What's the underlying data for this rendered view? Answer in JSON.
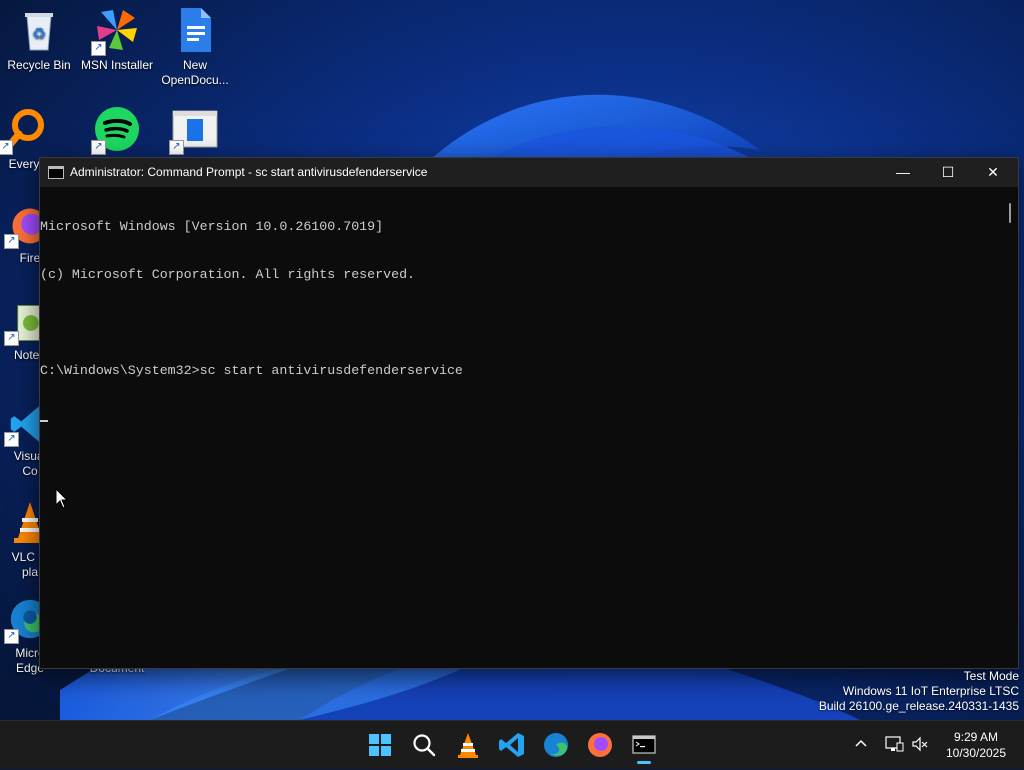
{
  "desktop": {
    "icons": [
      {
        "label": "Recycle Bin",
        "icon": "recycle-bin-icon"
      },
      {
        "label": "MSN Installer",
        "icon": "msn-icon"
      },
      {
        "label": "New OpenDocu...",
        "icon": "document-icon"
      },
      {
        "label": "Every",
        "icon": "everything-search-icon"
      },
      {
        "label": "",
        "icon": "spotify-icon"
      },
      {
        "label": "",
        "icon": "window-app-icon"
      },
      {
        "label": "Fire",
        "icon": "firefox-icon"
      },
      {
        "label": "Notep",
        "icon": "notepad-icon"
      },
      {
        "label": "Visual\nCo",
        "icon": "vscode-icon"
      },
      {
        "label": "VLC m\npla",
        "icon": "vlc-icon"
      },
      {
        "label": "Micro\nEdge",
        "icon": "edge-icon"
      },
      {
        "label": "Document",
        "icon": "document-icon"
      }
    ]
  },
  "window": {
    "title": "Administrator: Command Prompt - sc  start antivirusdefenderservice",
    "minimize": "—",
    "maximize": "☐",
    "close": "✕",
    "console_lines": [
      "Microsoft Windows [Version 10.0.26100.7019]",
      "(c) Microsoft Corporation. All rights reserved.",
      "",
      "C:\\Windows\\System32>sc start antivirusdefenderservice"
    ]
  },
  "watermark": {
    "line1": "Test Mode",
    "line2": "Windows 11 IoT Enterprise LTSC",
    "line3": "Build 26100.ge_release.240331-1435"
  },
  "taskbar": {
    "apps": [
      "start-icon",
      "search-icon",
      "vlc-icon",
      "vscode-icon",
      "edge-icon",
      "firefox-icon",
      "terminal-icon"
    ],
    "active": "terminal-icon"
  },
  "clock": {
    "time": "9:29 AM",
    "date": "10/30/2025"
  },
  "colors": {
    "console_bg": "#0c0c0c",
    "console_fg": "#cccccc",
    "titlebar_bg": "#1f1f1f",
    "taskbar_bg": "#1c1c1c",
    "accent": "#4cc2ff"
  }
}
